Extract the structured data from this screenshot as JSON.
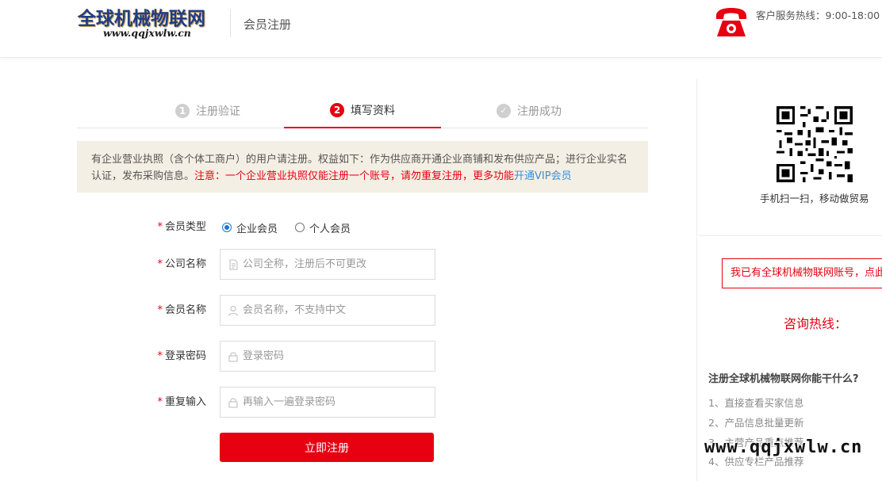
{
  "header": {
    "logo_main": "全球机械物联网",
    "logo_sub": "www.qqjxwlw.cn",
    "title": "会员注册",
    "hotline": "客户服务热线：9:00-18:00"
  },
  "steps": [
    {
      "num": "1",
      "label": "注册验证",
      "active": false
    },
    {
      "num": "2",
      "label": "填写资料",
      "active": true
    },
    {
      "num": "✓",
      "label": "注册成功",
      "active": false
    }
  ],
  "notice": {
    "text": "有企业营业执照（含个体工商户）的用户请注册。权益如下：作为供应商开通企业商铺和发布供应产品；进行企业实名认证，发布采购信息。",
    "warning": "注意：一个企业营业执照仅能注册一个账号，请勿重复注册，更多功能",
    "vip_link": "开通VIP会员"
  },
  "form": {
    "member_type": {
      "label": "会员类型",
      "options": [
        "企业会员",
        "个人会员"
      ],
      "selected": "企业会员"
    },
    "company_name": {
      "label": "公司名称",
      "placeholder": "公司全称，注册后不可更改",
      "value": ""
    },
    "member_name": {
      "label": "会员名称",
      "placeholder": "会员名称，不支持中文",
      "value": ""
    },
    "password": {
      "label": "登录密码",
      "placeholder": "登录密码",
      "value": ""
    },
    "repeat_password": {
      "label": "重复输入",
      "placeholder": "再输入一遍登录密码",
      "value": ""
    },
    "submit_label": "立即注册"
  },
  "sidebar": {
    "qr_caption": "手机扫一扫，移动做贸易",
    "login_link": "我已有全球机械物联网账号，点此登录",
    "consult": "咨询热线：",
    "why_title": "注册全球机械物联网你能干什么?",
    "why_items": [
      "1、直接查看买家信息",
      "2、产品信息批量更新",
      "3、主营产品重点推荐",
      "4、供应专栏产品推荐"
    ],
    "watermark": "www.qqjxwlw.cn"
  },
  "colors": {
    "accent": "#e60012",
    "link": "#3a8fd8",
    "notice_bg": "#f4efe4",
    "logo_blue": "#1f3c88"
  }
}
